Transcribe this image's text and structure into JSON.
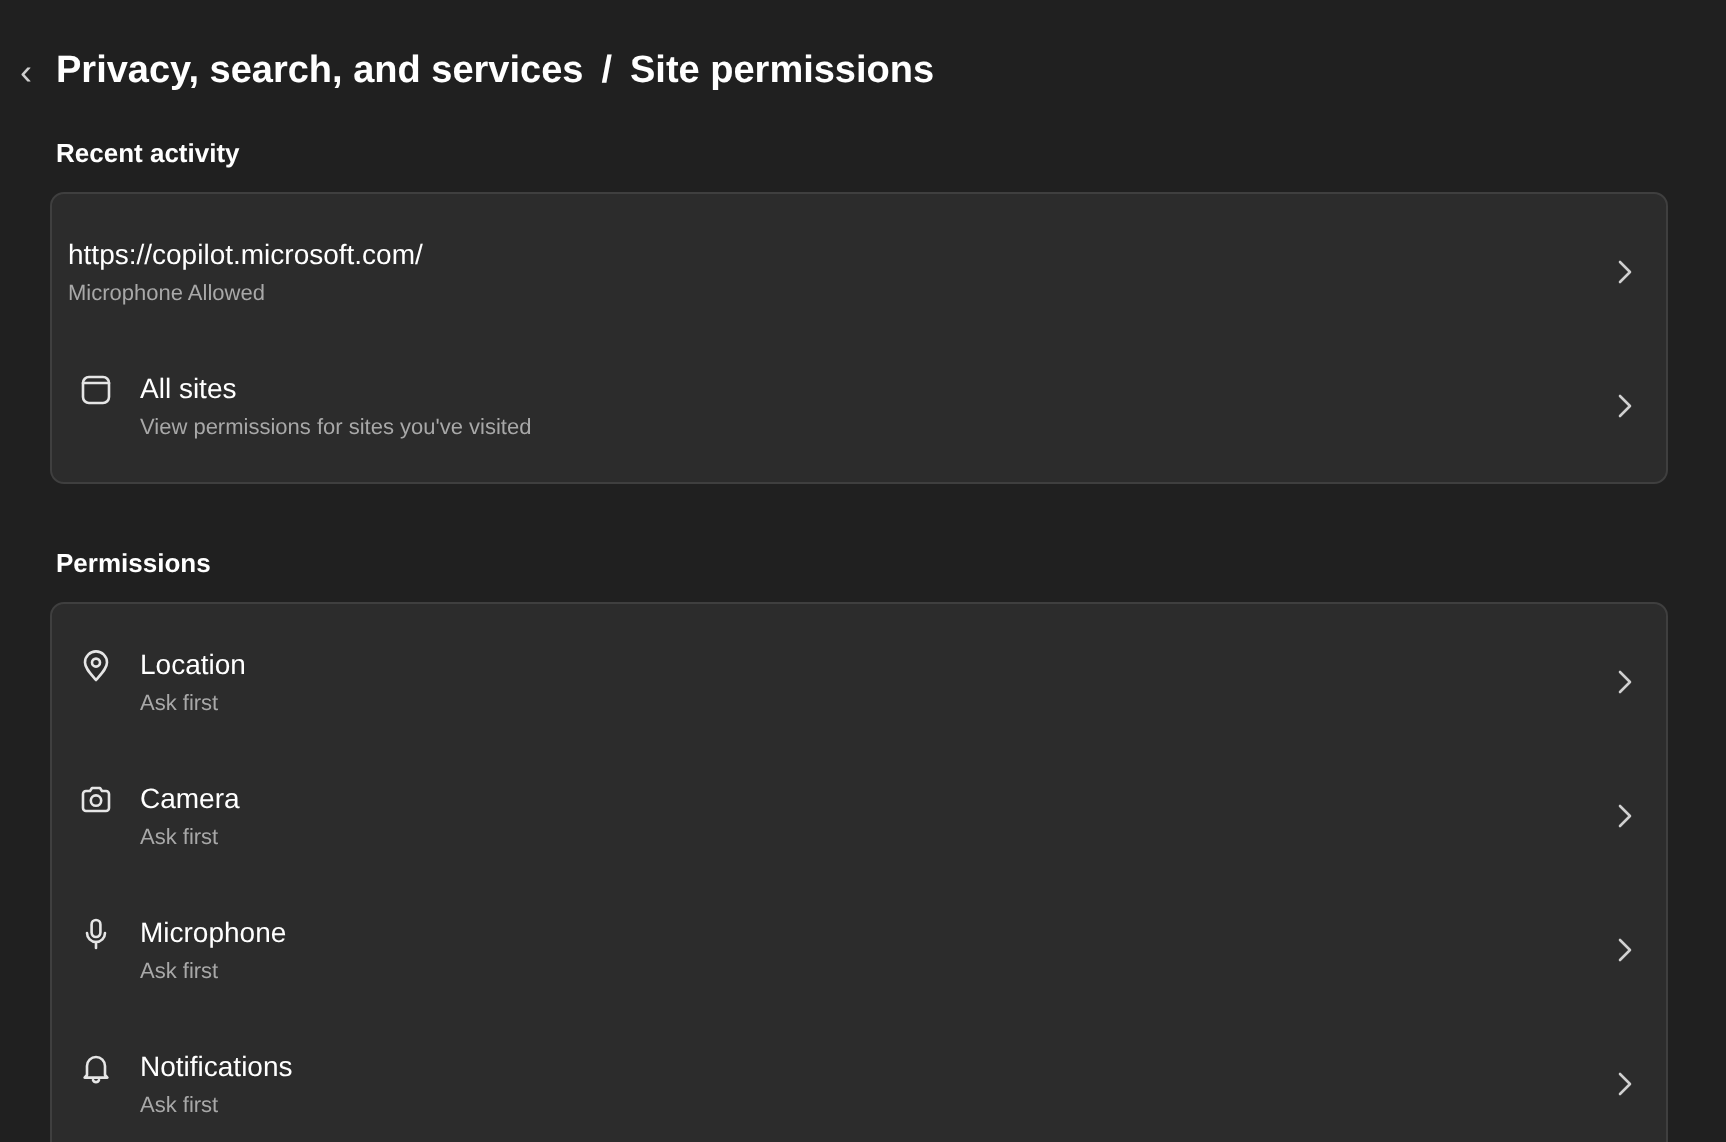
{
  "header": {
    "back": "‹",
    "title": "Privacy, search, and services",
    "separator": "/",
    "current": "Site permissions"
  },
  "sections": [
    {
      "heading": "Recent activity",
      "items": [
        {
          "kind": "site",
          "title": "https://copilot.microsoft.com/",
          "subtitle": "Microphone Allowed"
        },
        {
          "kind": "all-sites",
          "title": "All sites",
          "subtitle": "View permissions for sites you've visited"
        }
      ]
    },
    {
      "heading": "Permissions",
      "items": [
        {
          "kind": "location",
          "title": "Location",
          "subtitle": "Ask first"
        },
        {
          "kind": "camera",
          "title": "Camera",
          "subtitle": "Ask first"
        },
        {
          "kind": "microphone",
          "title": "Microphone",
          "subtitle": "Ask first"
        },
        {
          "kind": "notifications",
          "title": "Notifications",
          "subtitle": "Ask first"
        }
      ]
    }
  ]
}
